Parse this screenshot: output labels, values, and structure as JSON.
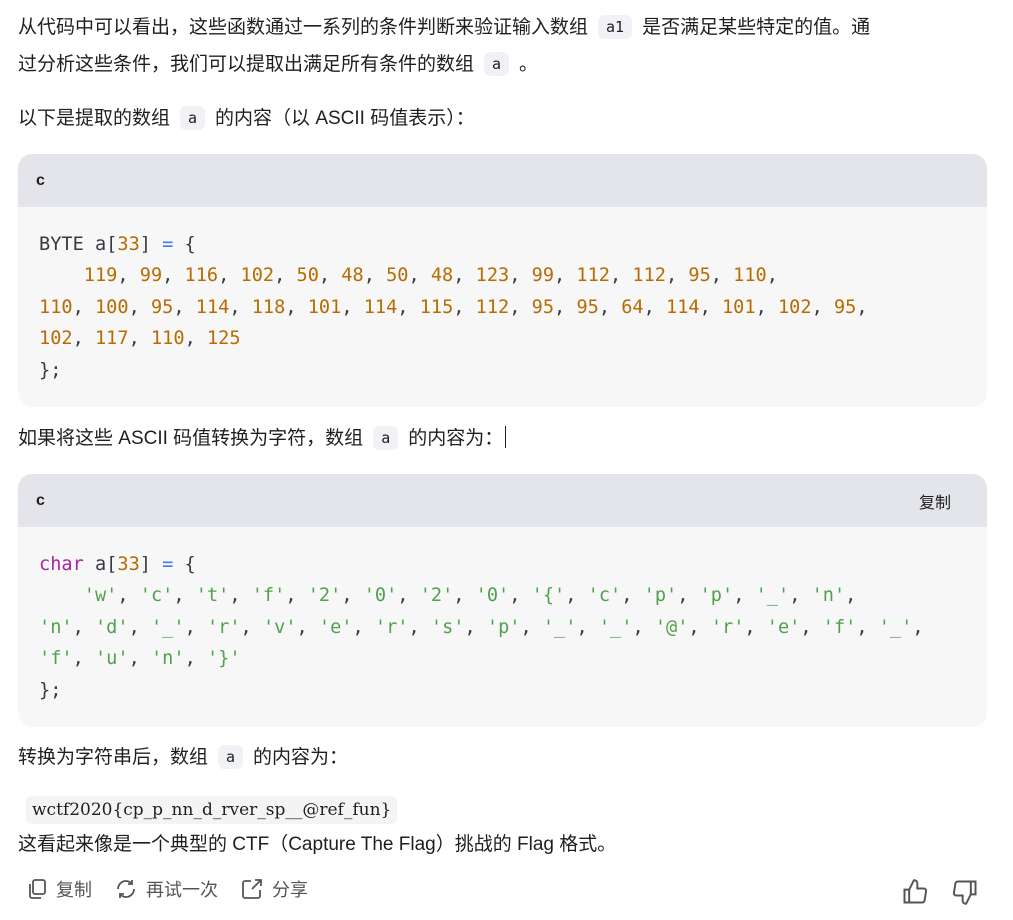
{
  "intro": {
    "line1_a": "从代码中可以看出，这些函数通过一系列的条件判断来验证输入数组",
    "line1_code": "a1",
    "line1_b": "是否满足某些特定的值。通",
    "line2_a": "过分析这些条件，我们可以提取出满足所有条件的数组",
    "line2_code": "a",
    "line2_b": "。"
  },
  "para2": {
    "a": "以下是提取的数组",
    "code": "a",
    "b": "的内容（以 ASCII 码值表示）："
  },
  "code_block_1": {
    "lang": "c",
    "decl_type": "BYTE",
    "decl_name": "a",
    "decl_size": "33",
    "values": [
      119,
      99,
      116,
      102,
      50,
      48,
      50,
      48,
      123,
      99,
      112,
      112,
      95,
      110,
      110,
      100,
      95,
      114,
      118,
      101,
      114,
      115,
      112,
      95,
      95,
      64,
      114,
      101,
      102,
      95,
      102,
      117,
      110,
      125
    ],
    "line_breaks_after": [
      13,
      29
    ]
  },
  "para3": {
    "a": "如果将这些 ASCII 码值转换为字符，数组",
    "code": "a",
    "b": "的内容为："
  },
  "code_block_2": {
    "lang": "c",
    "copy_label": "复制",
    "decl_type": "char",
    "decl_name": "a",
    "decl_size": "33",
    "chars": [
      "'w'",
      "'c'",
      "'t'",
      "'f'",
      "'2'",
      "'0'",
      "'2'",
      "'0'",
      "'{'",
      "'c'",
      "'p'",
      "'p'",
      "'_'",
      "'n'",
      "'n'",
      "'d'",
      "'_'",
      "'r'",
      "'v'",
      "'e'",
      "'r'",
      "'s'",
      "'p'",
      "'_'",
      "'_'",
      "'@'",
      "'r'",
      "'e'",
      "'f'",
      "'_'",
      "'f'",
      "'u'",
      "'n'",
      "'}'"
    ],
    "line_breaks_after": [
      13,
      29
    ]
  },
  "para4": {
    "a": "转换为字符串后，数组",
    "code": "a",
    "b": "的内容为："
  },
  "flag_value": "wctf2020{cp_p_nn_d_rver_sp__@ref_fun}",
  "para5": "这看起来像是一个典型的 CTF（Capture The Flag）挑战的 Flag 格式。",
  "actions": {
    "copy": "复制",
    "retry": "再试一次",
    "share": "分享"
  },
  "colors": {
    "number": "#b76b01",
    "keyword": "#a626a4",
    "string": "#50a14f",
    "punct": "#4078f2"
  }
}
